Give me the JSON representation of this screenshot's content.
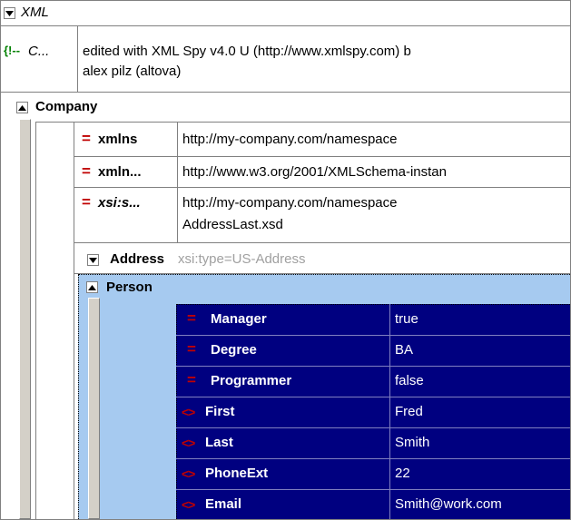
{
  "tree": {
    "root_label": "XML",
    "comment": {
      "label": "C...",
      "text_line1": "edited with XML Spy v4.0 U (http://www.xmlspy.com) b",
      "text_line2": "alex pilz (altova)"
    },
    "company": {
      "label": "Company",
      "attributes": [
        {
          "name": "xmlns",
          "value": "http://my-company.com/namespace"
        },
        {
          "name": "xmln...",
          "value": "http://www.w3.org/2001/XMLSchema-instan"
        },
        {
          "name": "xsi:s...",
          "value_line1": "http://my-company.com/namespace",
          "value_line2": "AddressLast.xsd"
        }
      ],
      "address": {
        "label": "Address",
        "type_hint": "xsi:type=US-Address",
        "person": {
          "label": "Person",
          "attributes": [
            {
              "name": "Manager",
              "value": "true"
            },
            {
              "name": "Degree",
              "value": "BA"
            },
            {
              "name": "Programmer",
              "value": "false"
            }
          ],
          "elements": [
            {
              "name": "First",
              "value": "Fred"
            },
            {
              "name": "Last",
              "value": "Smith"
            },
            {
              "name": "PhoneExt",
              "value": "22"
            },
            {
              "name": "Email",
              "value": "Smith@work.com"
            }
          ]
        }
      }
    }
  },
  "colors": {
    "selection_bg": "#000080",
    "person_bg": "#a6caf0",
    "symbol_red": "#c00000",
    "comment_green": "#008000"
  },
  "icons": {
    "attribute": "equals-sign",
    "element": "angle-brackets",
    "comment": "comment-glyph",
    "expand": "triangle-down",
    "collapse": "triangle-up"
  }
}
